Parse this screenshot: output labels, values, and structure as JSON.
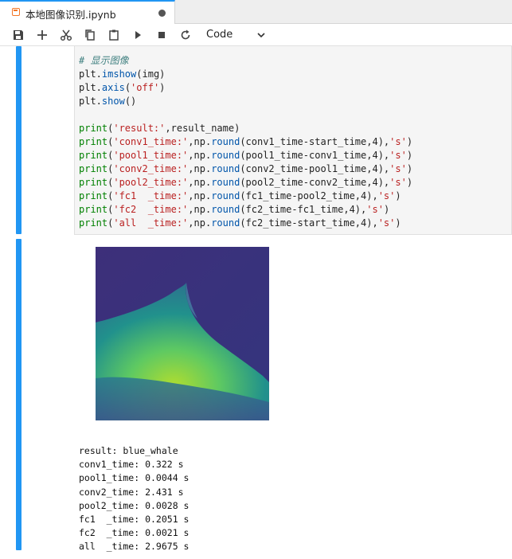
{
  "tab": {
    "title": "本地图像识别.ipynb",
    "unsaved_indicator": "modified-dot"
  },
  "toolbar": {
    "buttons": [
      "save-icon",
      "add-icon",
      "cut-icon",
      "copy-icon",
      "paste-icon",
      "run-icon",
      "stop-icon",
      "restart-icon"
    ],
    "cell_type": "Code"
  },
  "colors": {
    "accent": "#2196f3",
    "tab_icon": "#f37626"
  },
  "code_lines": [
    "# 显示图像",
    "plt.imshow(img)",
    "plt.axis('off')",
    "plt.show()",
    "",
    "print('result:',result_name)",
    "print('conv1_time:',np.round(conv1_time-start_time,4),'s')",
    "print('pool1_time:',np.round(pool1_time-conv1_time,4),'s')",
    "print('conv2_time:',np.round(conv2_time-pool1_time,4),'s')",
    "print('pool2_time:',np.round(pool2_time-conv2_time,4),'s')",
    "print('fc1  _time:',np.round(fc1_time-pool2_time,4),'s')",
    "print('fc2  _time:',np.round(fc2_time-fc1_time,4),'s')",
    "print('all  _time:',np.round(fc2_time-start_time,4),'s')"
  ],
  "output_lines": [
    "result: blue_whale",
    "conv1_time: 0.322 s",
    "pool1_time: 0.0044 s",
    "conv2_time: 2.431 s",
    "pool2_time: 0.0028 s",
    "fc1  _time: 0.2051 s",
    "fc2  _time: 0.0021 s",
    "all  _time: 2.9675 s"
  ]
}
